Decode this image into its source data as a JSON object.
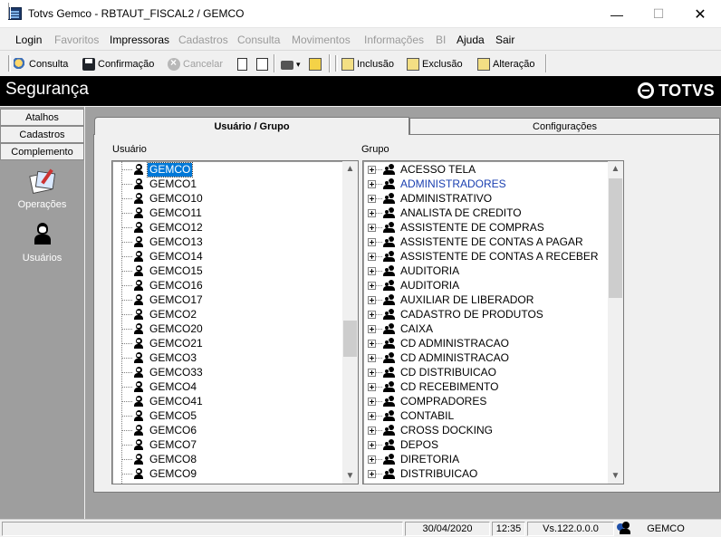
{
  "window": {
    "title": "Totvs Gemco - RBTAUT_FISCAL2 / GEMCO",
    "minimize": "—",
    "maximize": "☐",
    "close": "✕"
  },
  "menu": [
    {
      "label": "Login",
      "enabled": true
    },
    {
      "label": "Favoritos",
      "enabled": false
    },
    {
      "label": "Impressoras",
      "enabled": true
    },
    {
      "label": "Cadastros",
      "enabled": false
    },
    {
      "label": "Consulta",
      "enabled": false
    },
    {
      "label": "Movimentos",
      "enabled": false
    },
    {
      "label": "Informações",
      "enabled": false
    },
    {
      "label": "BI",
      "enabled": false
    },
    {
      "label": "Ajuda",
      "enabled": true
    },
    {
      "label": "Sair",
      "enabled": true
    }
  ],
  "toolbar": {
    "consulta": "Consulta",
    "confirmacao": "Confirmação",
    "cancelar": "Cancelar",
    "inclusao": "Inclusão",
    "exclusao": "Exclusão",
    "alteracao": "Alteração",
    "dropdown_arrow": "▾"
  },
  "header": {
    "module_title": "Segurança",
    "brand": "TOTVS"
  },
  "sidebar": {
    "tabs": [
      "Atalhos",
      "Cadastros",
      "Complemento"
    ],
    "items": [
      {
        "label": "Operações",
        "icon": "operations-icon"
      },
      {
        "label": "Usuários",
        "icon": "user-icon"
      }
    ]
  },
  "tabs": {
    "user_group": "Usuário  / Grupo",
    "config": "Configurações"
  },
  "labels": {
    "user": "Usuário",
    "group": "Grupo"
  },
  "users": [
    "GEMCO",
    "GEMCO1",
    "GEMCO10",
    "GEMCO11",
    "GEMCO12",
    "GEMCO13",
    "GEMCO14",
    "GEMCO15",
    "GEMCO16",
    "GEMCO17",
    "GEMCO2",
    "GEMCO20",
    "GEMCO21",
    "GEMCO3",
    "GEMCO33",
    "GEMCO4",
    "GEMCO41",
    "GEMCO5",
    "GEMCO6",
    "GEMCO7",
    "GEMCO8",
    "GEMCO9"
  ],
  "selected_user": "GEMCO",
  "groups": [
    "ACESSO TELA",
    "ADMINISTRADORES",
    "ADMINISTRATIVO",
    "ANALISTA DE CREDITO",
    "ASSISTENTE DE COMPRAS",
    "ASSISTENTE DE CONTAS A PAGAR",
    "ASSISTENTE DE CONTAS A RECEBER",
    "AUDITORIA",
    "AUDITORIA",
    "AUXILIAR DE LIBERADOR",
    "CADASTRO DE PRODUTOS",
    "CAIXA",
    "CD ADMINISTRACAO",
    "CD ADMINISTRACAO",
    "CD DISTRIBUICAO",
    "CD RECEBIMENTO",
    "COMPRADORES",
    "CONTABIL",
    "CROSS DOCKING",
    "DEPOS",
    "DIRETORIA",
    "DISTRIBUICAO"
  ],
  "highlighted_group": "ADMINISTRADORES",
  "scroll": {
    "up": "▲",
    "down": "▼"
  },
  "status": {
    "date": "30/04/2020",
    "time": "12:35",
    "version": "Vs.122.0.0.0",
    "company": "GEMCO"
  }
}
